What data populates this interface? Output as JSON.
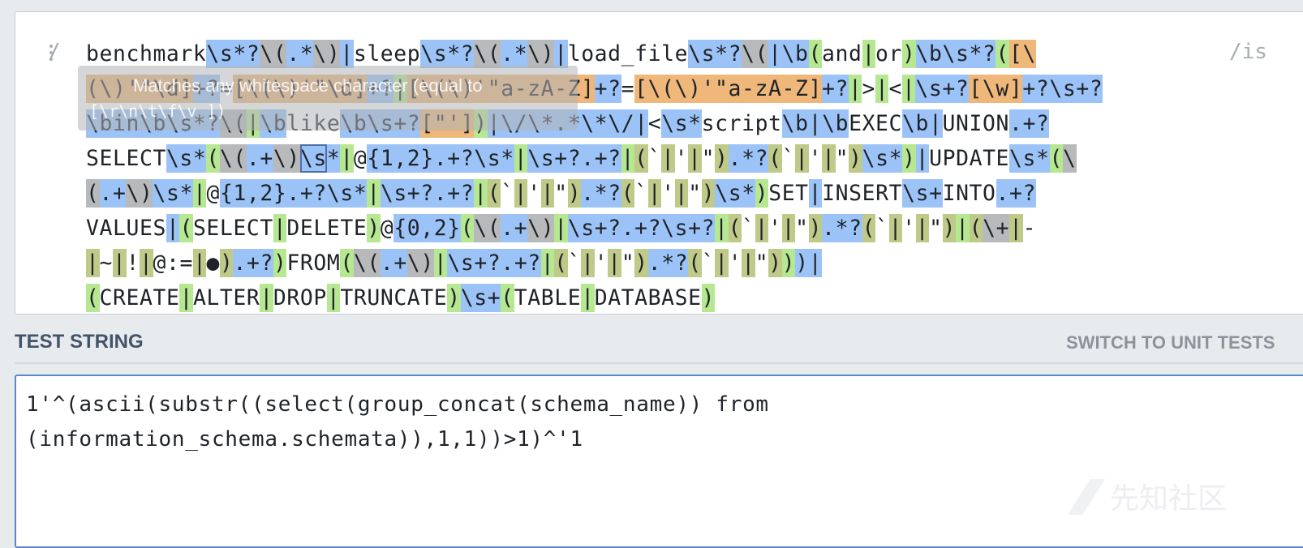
{
  "regex_editor": {
    "open_delimiter": "/",
    "close_delimiter": "/",
    "flags": "is",
    "lines": [
      [
        {
          "t": "benchmark",
          "c": ""
        },
        {
          "t": "\\s*?",
          "c": "h-b"
        },
        {
          "t": "\\(",
          "c": "h-k"
        },
        {
          "t": ".*",
          "c": "h-b"
        },
        {
          "t": "\\)",
          "c": "h-k"
        },
        {
          "t": "|",
          "c": "h-b"
        },
        {
          "t": "sleep",
          "c": ""
        },
        {
          "t": "\\s*?",
          "c": "h-b"
        },
        {
          "t": "\\(",
          "c": "h-k"
        },
        {
          "t": ".*",
          "c": "h-b"
        },
        {
          "t": "\\)",
          "c": "h-k"
        },
        {
          "t": "|",
          "c": "h-b"
        },
        {
          "t": "load_file",
          "c": ""
        },
        {
          "t": "\\s*?",
          "c": "h-b"
        },
        {
          "t": "\\(",
          "c": "h-k"
        },
        {
          "t": "|",
          "c": "h-b"
        },
        {
          "t": "\\b",
          "c": "h-b"
        },
        {
          "t": "(",
          "c": "h-g"
        },
        {
          "t": "and",
          "c": ""
        },
        {
          "t": "|",
          "c": "h-g"
        },
        {
          "t": "or",
          "c": ""
        },
        {
          "t": ")",
          "c": "h-g"
        },
        {
          "t": "\\b",
          "c": "h-b"
        },
        {
          "t": "\\s*?",
          "c": "h-b"
        },
        {
          "t": "(",
          "c": "h-g"
        },
        {
          "t": "[\\",
          "c": "h-o"
        }
      ],
      [
        {
          "t": "(\\)'\"\\d]",
          "c": "h-o"
        },
        {
          "t": "+?",
          "c": "h-b"
        },
        {
          "t": "=",
          "c": ""
        },
        {
          "t": "[\\(\\)'\"\\d]",
          "c": "h-o"
        },
        {
          "t": "+?",
          "c": "h-b"
        },
        {
          "t": "|",
          "c": "h-g"
        },
        {
          "t": "[\\(\\)'\"a-zA-Z]",
          "c": "h-o"
        },
        {
          "t": "+?",
          "c": "h-b"
        },
        {
          "t": "=",
          "c": ""
        },
        {
          "t": "[\\(\\)'\"a-zA-Z]",
          "c": "h-o"
        },
        {
          "t": "+?",
          "c": "h-b"
        },
        {
          "t": "|",
          "c": "h-g"
        },
        {
          "t": ">",
          "c": ""
        },
        {
          "t": "|",
          "c": "h-g"
        },
        {
          "t": "<",
          "c": ""
        },
        {
          "t": "|",
          "c": "h-g"
        },
        {
          "t": "\\s+?",
          "c": "h-b"
        },
        {
          "t": "[\\w]",
          "c": "h-o"
        },
        {
          "t": "+?",
          "c": "h-b"
        },
        {
          "t": "\\s+?",
          "c": "h-b"
        }
      ],
      [
        {
          "t": "\\bin",
          "c": "h-b"
        },
        {
          "t": "\\b",
          "c": "h-b"
        },
        {
          "t": "\\s*?",
          "c": "h-b"
        },
        {
          "t": "\\(",
          "c": "h-k"
        },
        {
          "t": "|",
          "c": "h-g"
        },
        {
          "t": "\\b",
          "c": "h-b"
        },
        {
          "t": "like",
          "c": ""
        },
        {
          "t": "\\b",
          "c": "h-b"
        },
        {
          "t": "\\s+?",
          "c": "h-b"
        },
        {
          "t": "[\"']",
          "c": "h-o"
        },
        {
          "t": ")",
          "c": "h-g"
        },
        {
          "t": "|",
          "c": "h-b"
        },
        {
          "t": "\\/\\*",
          "c": "h-b"
        },
        {
          "t": ".*",
          "c": "h-b"
        },
        {
          "t": "\\*\\/",
          "c": "h-b"
        },
        {
          "t": "|",
          "c": "h-b"
        },
        {
          "t": "<",
          "c": ""
        },
        {
          "t": "\\s*",
          "c": "h-b"
        },
        {
          "t": "script",
          "c": ""
        },
        {
          "t": "\\b",
          "c": "h-b"
        },
        {
          "t": "|",
          "c": "h-b"
        },
        {
          "t": "\\b",
          "c": "h-b"
        },
        {
          "t": "EXEC",
          "c": ""
        },
        {
          "t": "\\b",
          "c": "h-b"
        },
        {
          "t": "|",
          "c": "h-b"
        },
        {
          "t": "UNION",
          "c": ""
        },
        {
          "t": ".+?",
          "c": "h-b"
        }
      ],
      [
        {
          "t": "SELECT",
          "c": ""
        },
        {
          "t": "\\s*",
          "c": "h-b"
        },
        {
          "t": "(",
          "c": "h-g"
        },
        {
          "t": "\\(",
          "c": "h-k"
        },
        {
          "t": ".+",
          "c": "h-b"
        },
        {
          "t": "\\)",
          "c": "h-k"
        },
        {
          "t": "\\s",
          "c": "h-b h-sel"
        },
        {
          "t": "*",
          "c": "h-b"
        },
        {
          "t": "|",
          "c": "h-g"
        },
        {
          "t": "@",
          "c": ""
        },
        {
          "t": "{1,2}",
          "c": "h-b"
        },
        {
          "t": ".+?",
          "c": "h-b"
        },
        {
          "t": "\\s*",
          "c": "h-b"
        },
        {
          "t": "|",
          "c": "h-g"
        },
        {
          "t": "\\s+?",
          "c": "h-b"
        },
        {
          "t": ".+?",
          "c": "h-b"
        },
        {
          "t": "|",
          "c": "h-g"
        },
        {
          "t": "(",
          "c": "h-y"
        },
        {
          "t": "`",
          "c": ""
        },
        {
          "t": "|",
          "c": "h-y"
        },
        {
          "t": "'",
          "c": ""
        },
        {
          "t": "|",
          "c": "h-y"
        },
        {
          "t": "\"",
          "c": ""
        },
        {
          "t": ")",
          "c": "h-y"
        },
        {
          "t": ".*?",
          "c": "h-b"
        },
        {
          "t": "(",
          "c": "h-y"
        },
        {
          "t": "`",
          "c": ""
        },
        {
          "t": "|",
          "c": "h-y"
        },
        {
          "t": "'",
          "c": ""
        },
        {
          "t": "|",
          "c": "h-y"
        },
        {
          "t": "\"",
          "c": ""
        },
        {
          "t": ")",
          "c": "h-y"
        },
        {
          "t": "\\s*",
          "c": "h-b"
        },
        {
          "t": ")",
          "c": "h-g"
        },
        {
          "t": "|",
          "c": "h-b"
        },
        {
          "t": "UPDATE",
          "c": ""
        },
        {
          "t": "\\s*",
          "c": "h-b"
        },
        {
          "t": "(",
          "c": "h-g"
        },
        {
          "t": "\\",
          "c": "h-k"
        }
      ],
      [
        {
          "t": "(",
          "c": "h-k"
        },
        {
          "t": ".+",
          "c": "h-b"
        },
        {
          "t": "\\)",
          "c": "h-k"
        },
        {
          "t": "\\s*",
          "c": "h-b"
        },
        {
          "t": "|",
          "c": "h-g"
        },
        {
          "t": "@",
          "c": ""
        },
        {
          "t": "{1,2}",
          "c": "h-b"
        },
        {
          "t": ".+?",
          "c": "h-b"
        },
        {
          "t": "\\s*",
          "c": "h-b"
        },
        {
          "t": "|",
          "c": "h-g"
        },
        {
          "t": "\\s+?",
          "c": "h-b"
        },
        {
          "t": ".+?",
          "c": "h-b"
        },
        {
          "t": "|",
          "c": "h-g"
        },
        {
          "t": "(",
          "c": "h-y"
        },
        {
          "t": "`",
          "c": ""
        },
        {
          "t": "|",
          "c": "h-y"
        },
        {
          "t": "'",
          "c": ""
        },
        {
          "t": "|",
          "c": "h-y"
        },
        {
          "t": "\"",
          "c": ""
        },
        {
          "t": ")",
          "c": "h-y"
        },
        {
          "t": ".*?",
          "c": "h-b"
        },
        {
          "t": "(",
          "c": "h-y"
        },
        {
          "t": "`",
          "c": ""
        },
        {
          "t": "|",
          "c": "h-y"
        },
        {
          "t": "'",
          "c": ""
        },
        {
          "t": "|",
          "c": "h-y"
        },
        {
          "t": "\"",
          "c": ""
        },
        {
          "t": ")",
          "c": "h-y"
        },
        {
          "t": "\\s*",
          "c": "h-b"
        },
        {
          "t": ")",
          "c": "h-g"
        },
        {
          "t": "SET",
          "c": ""
        },
        {
          "t": "|",
          "c": "h-b"
        },
        {
          "t": "INSERT",
          "c": ""
        },
        {
          "t": "\\s+",
          "c": "h-b"
        },
        {
          "t": "INTO",
          "c": ""
        },
        {
          "t": ".+?",
          "c": "h-b"
        }
      ],
      [
        {
          "t": "VALUES",
          "c": ""
        },
        {
          "t": "|",
          "c": "h-b"
        },
        {
          "t": "(",
          "c": "h-g"
        },
        {
          "t": "SELECT",
          "c": ""
        },
        {
          "t": "|",
          "c": "h-g"
        },
        {
          "t": "DELETE",
          "c": ""
        },
        {
          "t": ")",
          "c": "h-g"
        },
        {
          "t": "@",
          "c": ""
        },
        {
          "t": "{0,2}",
          "c": "h-b"
        },
        {
          "t": "(",
          "c": "h-g"
        },
        {
          "t": "\\(",
          "c": "h-k"
        },
        {
          "t": ".+",
          "c": "h-b"
        },
        {
          "t": "\\)",
          "c": "h-k"
        },
        {
          "t": "|",
          "c": "h-g"
        },
        {
          "t": "\\s+?",
          "c": "h-b"
        },
        {
          "t": ".+?",
          "c": "h-b"
        },
        {
          "t": "\\s+?",
          "c": "h-b"
        },
        {
          "t": "|",
          "c": "h-g"
        },
        {
          "t": "(",
          "c": "h-y"
        },
        {
          "t": "`",
          "c": ""
        },
        {
          "t": "|",
          "c": "h-y"
        },
        {
          "t": "'",
          "c": ""
        },
        {
          "t": "|",
          "c": "h-y"
        },
        {
          "t": "\"",
          "c": ""
        },
        {
          "t": ")",
          "c": "h-y"
        },
        {
          "t": ".*?",
          "c": "h-b"
        },
        {
          "t": "(",
          "c": "h-y"
        },
        {
          "t": "`",
          "c": ""
        },
        {
          "t": "|",
          "c": "h-y"
        },
        {
          "t": "'",
          "c": ""
        },
        {
          "t": "|",
          "c": "h-y"
        },
        {
          "t": "\"",
          "c": ""
        },
        {
          "t": ")",
          "c": "h-y"
        },
        {
          "t": "|",
          "c": "h-g"
        },
        {
          "t": "(",
          "c": "h-y"
        },
        {
          "t": "\\+",
          "c": "h-k"
        },
        {
          "t": "|",
          "c": "h-y"
        },
        {
          "t": "-",
          "c": ""
        }
      ],
      [
        {
          "t": "|",
          "c": "h-y"
        },
        {
          "t": "~",
          "c": ""
        },
        {
          "t": "|",
          "c": "h-y"
        },
        {
          "t": "!",
          "c": ""
        },
        {
          "t": "|",
          "c": "h-y"
        },
        {
          "t": "@:=",
          "c": ""
        },
        {
          "t": "|",
          "c": "h-y"
        },
        {
          "t": "●",
          "c": ""
        },
        {
          "t": ")",
          "c": "h-y"
        },
        {
          "t": ".+?",
          "c": "h-b"
        },
        {
          "t": ")",
          "c": "h-g"
        },
        {
          "t": "FROM",
          "c": ""
        },
        {
          "t": "(",
          "c": "h-g"
        },
        {
          "t": "\\(",
          "c": "h-k"
        },
        {
          "t": ".+",
          "c": "h-b"
        },
        {
          "t": "\\)",
          "c": "h-k"
        },
        {
          "t": "|",
          "c": "h-g"
        },
        {
          "t": "\\s+?",
          "c": "h-b"
        },
        {
          "t": ".+?",
          "c": "h-b"
        },
        {
          "t": "|",
          "c": "h-g"
        },
        {
          "t": "(",
          "c": "h-y"
        },
        {
          "t": "`",
          "c": ""
        },
        {
          "t": "|",
          "c": "h-y"
        },
        {
          "t": "'",
          "c": ""
        },
        {
          "t": "|",
          "c": "h-y"
        },
        {
          "t": "\"",
          "c": ""
        },
        {
          "t": ")",
          "c": "h-y"
        },
        {
          "t": ".*?",
          "c": "h-b"
        },
        {
          "t": "(",
          "c": "h-y"
        },
        {
          "t": "`",
          "c": ""
        },
        {
          "t": "|",
          "c": "h-y"
        },
        {
          "t": "'",
          "c": ""
        },
        {
          "t": "|",
          "c": "h-y"
        },
        {
          "t": "\"",
          "c": ""
        },
        {
          "t": ")",
          "c": "h-y"
        },
        {
          "t": ")",
          "c": "h-g"
        },
        {
          "t": ")",
          "c": "h-b"
        },
        {
          "t": "|",
          "c": "h-b"
        }
      ],
      [
        {
          "t": "(",
          "c": "h-g"
        },
        {
          "t": "CREATE",
          "c": ""
        },
        {
          "t": "|",
          "c": "h-g"
        },
        {
          "t": "ALTER",
          "c": ""
        },
        {
          "t": "|",
          "c": "h-g"
        },
        {
          "t": "DROP",
          "c": ""
        },
        {
          "t": "|",
          "c": "h-g"
        },
        {
          "t": "TRUNCATE",
          "c": ""
        },
        {
          "t": ")",
          "c": "h-g"
        },
        {
          "t": "\\s+",
          "c": "h-b"
        },
        {
          "t": "(",
          "c": "h-g"
        },
        {
          "t": "TABLE",
          "c": ""
        },
        {
          "t": "|",
          "c": "h-g"
        },
        {
          "t": "DATABASE",
          "c": ""
        },
        {
          "t": ")",
          "c": "h-g"
        }
      ]
    ],
    "tooltip": {
      "text": "Matches any whitespace character (equal to",
      "code": "[\\r\\n\\t\\f\\v ])"
    }
  },
  "test_string": {
    "title": "TEST STRING",
    "switch_label": "SWITCH TO UNIT TESTS",
    "lines": [
      "1'^(ascii(substr((select(group_concat(schema_name)) from",
      "(information_schema.schemata)),1,1))>1)^'1"
    ]
  },
  "watermark": "先知社区",
  "colors": {
    "escape_blue": "#9cc3f7",
    "group_green": "#b6e791",
    "set_orange": "#efb77a",
    "paren_gray": "#b7b9ba",
    "nested_olive": "#bfca89",
    "title_text": "#43546a",
    "active_border": "#5b87c4"
  },
  "icons": [
    "drag-handle-icon"
  ]
}
